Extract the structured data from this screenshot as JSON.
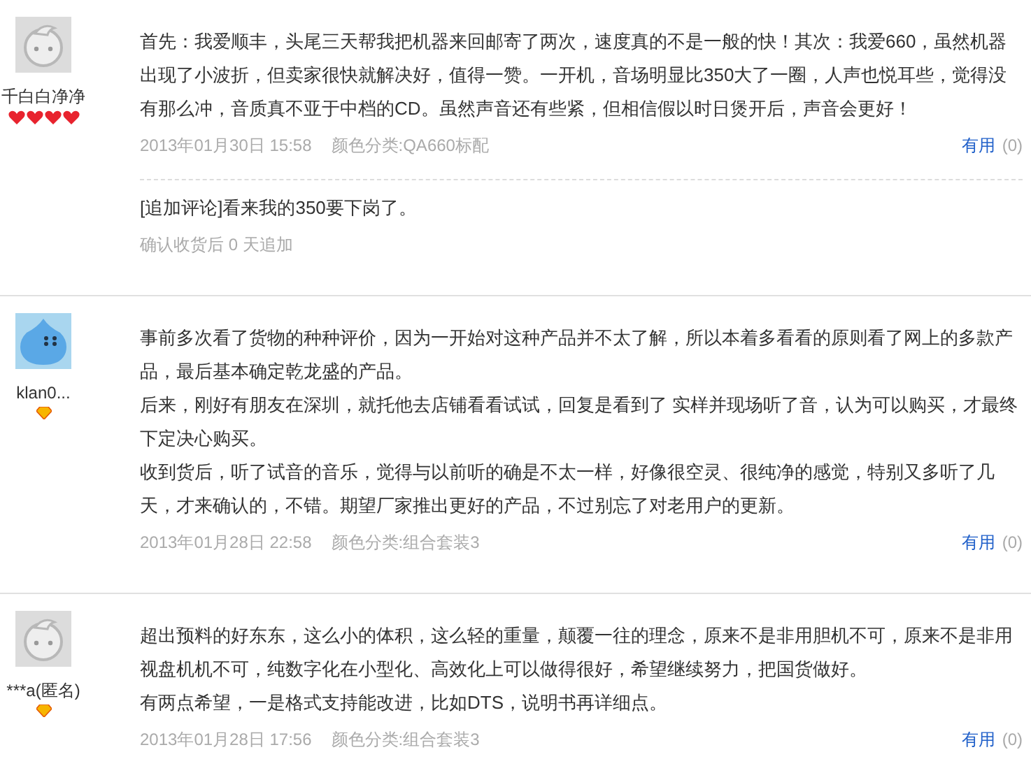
{
  "reviews": [
    {
      "avatar": {
        "kind": "face"
      },
      "user": "千白白净净",
      "rank_icons": [
        {
          "kind": "heart"
        },
        {
          "kind": "heart"
        },
        {
          "kind": "heart"
        },
        {
          "kind": "heart"
        }
      ],
      "paragraphs": [
        "首先：我爱顺丰，头尾三天帮我把机器来回邮寄了两次，速度真的不是一般的快！其次：我爱660，虽然机器出现了小波折，但卖家很快就解决好，值得一赞。一开机，音场明显比350大了一圈，人声也悦耳些，觉得没有那么冲，音质真不亚于中档的CD。虽然声音还有些紧，但相信假以时日煲开后，声音会更好！"
      ],
      "date": "2013年01月30日 15:58",
      "sku": "颜色分类:QA660标配",
      "useful": "有用",
      "useful_count": "(0)",
      "append": {
        "text": "[追加评论]看来我的350要下岗了。",
        "note": "确认收货后 0 天追加"
      }
    },
    {
      "avatar": {
        "kind": "drop"
      },
      "user": "klan0...",
      "rank_icons": [
        {
          "kind": "diamond"
        }
      ],
      "paragraphs": [
        "事前多次看了货物的种种评价，因为一开始对这种产品并不太了解，所以本着多看看的原则看了网上的多款产品，最后基本确定乾龙盛的产品。",
        "后来，刚好有朋友在深圳，就托他去店铺看看试试，回复是看到了 实样并现场听了音，认为可以购买，才最终下定决心购买。",
        "收到货后，听了试音的音乐，觉得与以前听的确是不太一样，好像很空灵、很纯净的感觉，特别又多听了几天，才来确认的，不错。期望厂家推出更好的产品，不过别忘了对老用户的更新。"
      ],
      "date": "2013年01月28日 22:58",
      "sku": "颜色分类:组合套装3",
      "useful": "有用",
      "useful_count": "(0)"
    },
    {
      "avatar": {
        "kind": "face"
      },
      "user": "***a(匿名)",
      "rank_icons": [
        {
          "kind": "diamond"
        }
      ],
      "paragraphs": [
        "超出预料的好东东，这么小的体积，这么轻的重量，颠覆一往的理念，原来不是非用胆机不可，原来不是非用视盘机机不可，纯数字化在小型化、高效化上可以做得很好，希望继续努力，把国货做好。",
        "有两点希望，一是格式支持能改进，比如DTS，说明书再详细点。"
      ],
      "date": "2013年01月28日 17:56",
      "sku": "颜色分类:组合套装3",
      "useful": "有用",
      "useful_count": "(0)"
    }
  ]
}
